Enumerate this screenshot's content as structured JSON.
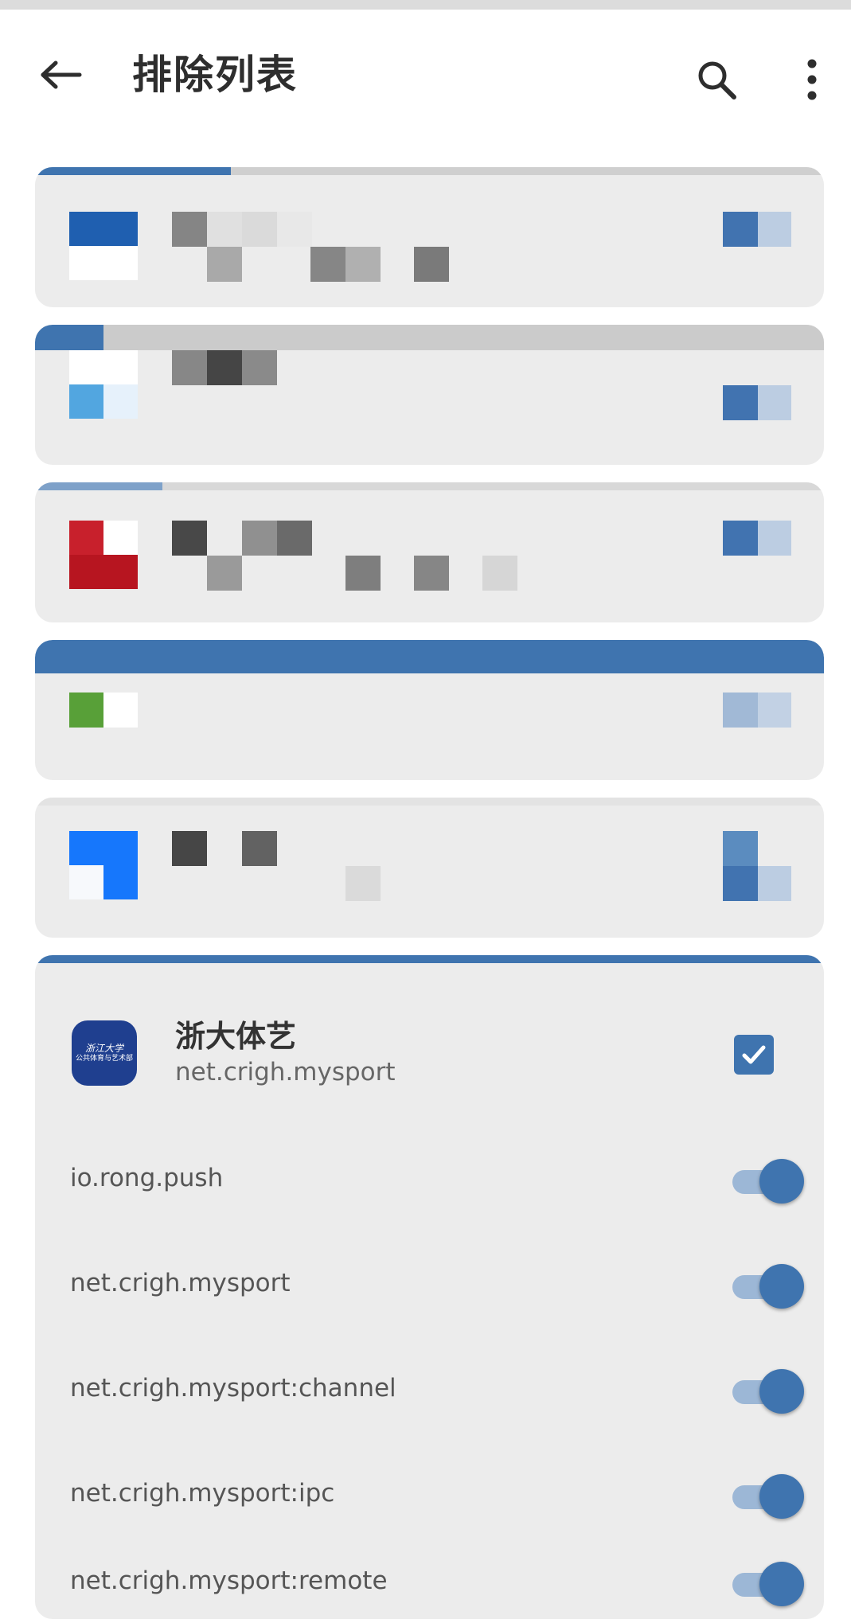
{
  "app_bar": {
    "title": "排除列表",
    "back_icon": "arrow-left-icon",
    "search_icon": "search-icon",
    "more_icon": "more-vertical-icon"
  },
  "colors": {
    "accent": "#3f74af",
    "accent_light": "#9cb7d6",
    "card_background": "#ececec",
    "title_text": "#2e2e2e"
  },
  "expanded_app": {
    "name": "浙大体艺",
    "package": "net.crigh.mysport",
    "icon_text_1": "浙江大学",
    "icon_text_2": "公共体育与艺术部",
    "checked": true,
    "processes": [
      {
        "name": "io.rong.push",
        "enabled": true
      },
      {
        "name": "net.crigh.mysport",
        "enabled": true
      },
      {
        "name": "net.crigh.mysport:channel",
        "enabled": true
      },
      {
        "name": "net.crigh.mysport:ipc",
        "enabled": true
      },
      {
        "name": "net.crigh.mysport:remote",
        "enabled": true
      }
    ]
  }
}
